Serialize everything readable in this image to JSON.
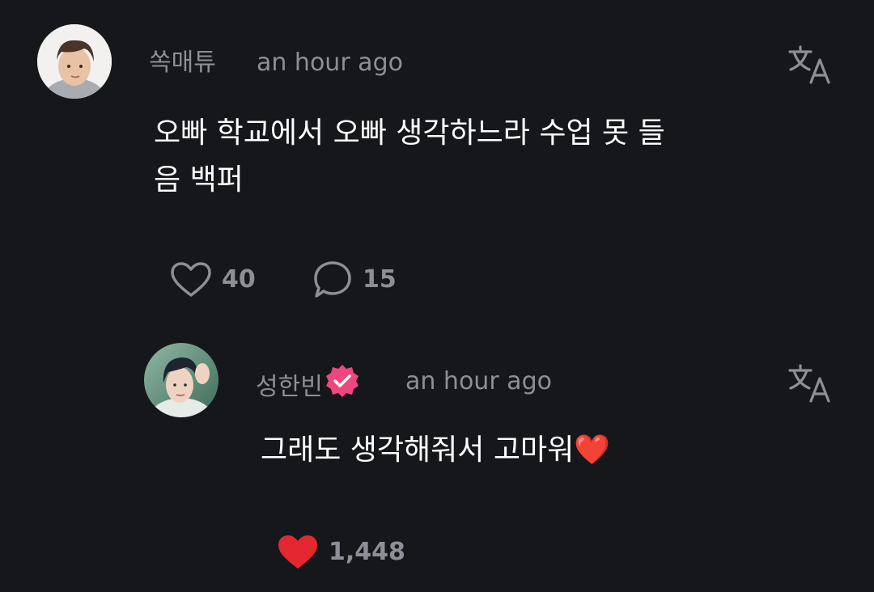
{
  "comments": [
    {
      "author": "쏙매튜",
      "time": "an hour ago",
      "text": "오빠 학교에서 오빠 생각하느라 수업 못 들\n음 백퍼",
      "likes": "40",
      "replies": "15",
      "liked": false,
      "avatar_icon": "child-avatar"
    },
    {
      "author": "성한빈",
      "verified": true,
      "time": "an hour ago",
      "text": "그래도 생각해줘서 고마워❤️",
      "likes": "1,448",
      "liked": true,
      "avatar_icon": "artist-avatar"
    }
  ],
  "icons": {
    "translate": "translate-icon",
    "like": "heart-icon",
    "reply": "speech-bubble-icon",
    "verified": "verified-badge-icon"
  },
  "colors": {
    "background": "#16171b",
    "muted_text": "#8e8e96",
    "like_active": "#e4272e",
    "verified_badge": "#f0467e"
  }
}
